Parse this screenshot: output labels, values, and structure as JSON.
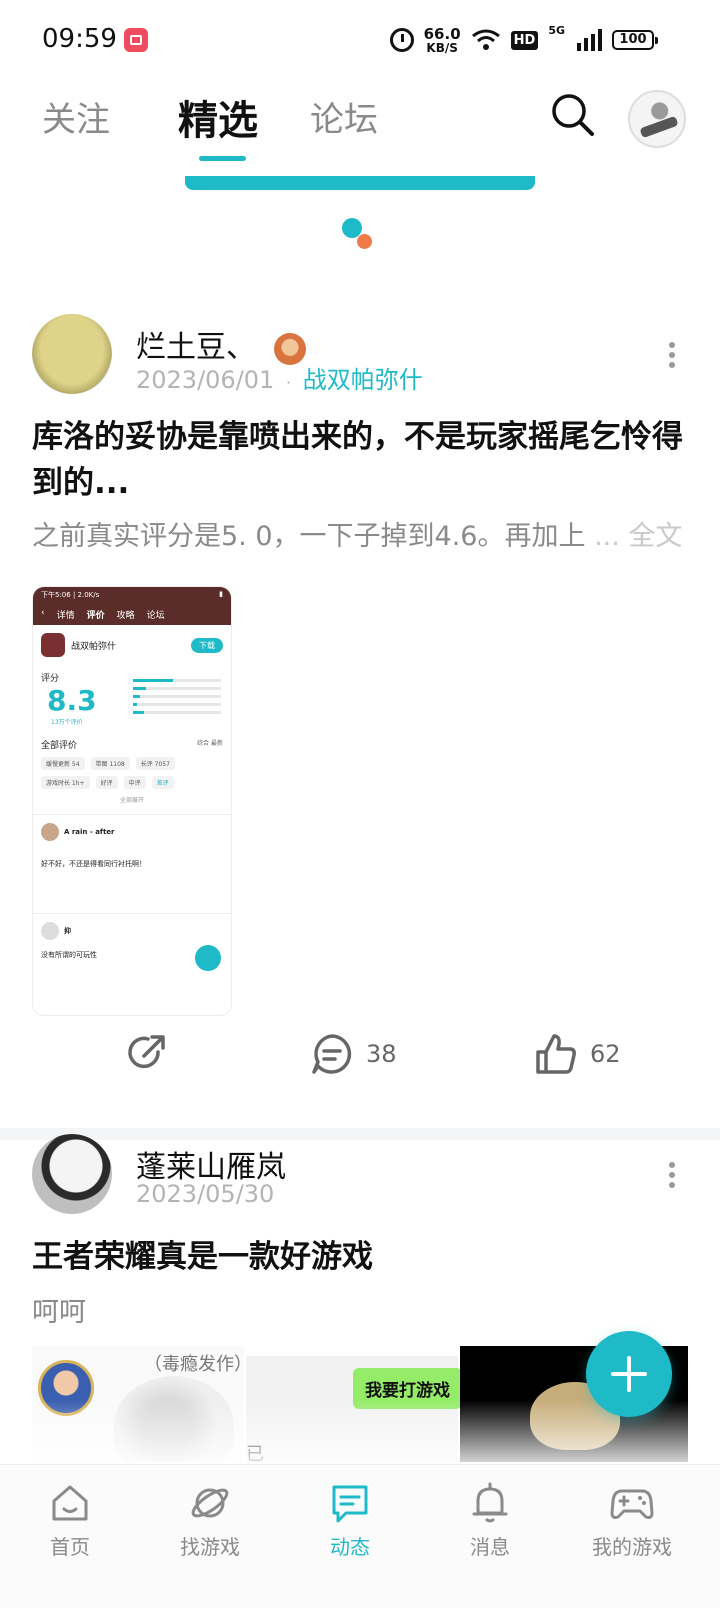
{
  "status_bar": {
    "time": "09:59",
    "speed_value": "66.0",
    "speed_unit": "KB/S",
    "hd": "HD",
    "network": "5G",
    "battery": "100"
  },
  "tabs": [
    {
      "label": "关注",
      "active": false
    },
    {
      "label": "精选",
      "active": true
    },
    {
      "label": "论坛",
      "active": false
    }
  ],
  "posts": [
    {
      "author": "烂土豆、",
      "date": "2023/06/01",
      "separator": "·",
      "game": "战双帕弥什",
      "title": "库洛的妥协是靠喷出来的，不是玩家摇尾乞怜得到的...",
      "body": "之前真实评分是5. 0，一下子掉到4.6。再加上",
      "ellipsis": "...",
      "full_text": "全文",
      "comments": "38",
      "likes": "62",
      "screenshot": {
        "status": "下午5:06 | 2.0K/s",
        "nav": [
          "详情",
          "评价",
          "攻略",
          "论坛"
        ],
        "forum": "论坛",
        "game_name": "战双帕弥什",
        "download": "下载",
        "score_label": "评分",
        "score": "8.3",
        "ratings_count": "13万个评价",
        "all_reviews": "全部评价",
        "sort": [
          "综合",
          "最新"
        ],
        "chips": [
          "缓慢更新 54",
          "带图 1108",
          "长评 7057",
          "游戏时长 1h+",
          "好评",
          "中评",
          "差评"
        ],
        "expand": "全部展开",
        "review1_user": "A rain - after",
        "review1_text": "好不好，不还是得看同行衬托啊！",
        "review2_user": "抑",
        "review2_text": "没有所谓的可玩性"
      }
    },
    {
      "author": "蓬莱山雁岚",
      "date": "2023/05/30",
      "title": "王者荣耀真是一款好游戏",
      "body": "呵呵",
      "img1_caption": "（毒瘾发作）",
      "img2_bubble": "我要打游戏",
      "img2_char": "已"
    }
  ],
  "bottom_nav": [
    {
      "label": "首页",
      "icon": "home-icon",
      "active": false
    },
    {
      "label": "找游戏",
      "icon": "planet-icon",
      "active": false
    },
    {
      "label": "动态",
      "icon": "feed-icon",
      "active": true
    },
    {
      "label": "消息",
      "icon": "bell-icon",
      "active": false
    },
    {
      "label": "我的游戏",
      "icon": "gamepad-icon",
      "active": false
    }
  ],
  "colors": {
    "accent": "#1fbac8",
    "loader_orange": "#f07a4a",
    "text_muted": "#8a8a8a"
  }
}
